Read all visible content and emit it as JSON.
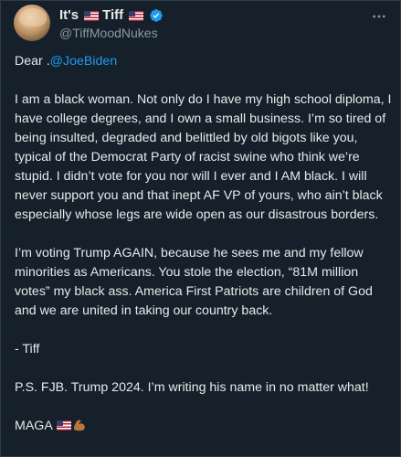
{
  "colors": {
    "background": "#15202b",
    "text": "#e7e9ea",
    "secondary_text": "#8b98a5",
    "link": "#1d9bf0",
    "verified": "#1d9bf0"
  },
  "author": {
    "display_name_prefix": "It's",
    "display_name_main": "Tiff",
    "handle": "@TiffMoodNukes",
    "flag_icon": "us-flag-icon",
    "verified_icon": "verified-badge-icon",
    "more_icon": "more-options-icon"
  },
  "tweet": {
    "greeting_prefix": "Dear .",
    "mention": "@JoeBiden",
    "paragraph_1": "I am a black woman. Not only do I have my high school diploma, I have college degrees, and I own a small business. I’m so tired of being insulted, degraded and belittled by old bigots like you, typical of the Democrat Party of racist swine who think we’re stupid. I didn’t vote for you nor will I ever and I AM black. I will never support you and that inept AF VP of yours, who ain’t black especially whose legs are wide open as our disastrous borders.",
    "paragraph_2": "I’m voting Trump AGAIN, because he sees me and my fellow minorities as Americans. You stole the election, “81M million votes” my black ass. America First Patriots are children of God and we are united in taking our country back.",
    "signoff": "- Tiff",
    "postscript": "P.S. FJB. Trump 2024. I’m writing his name in no matter what!",
    "closing": "MAGA",
    "closing_icons": [
      "us-flag-icon",
      "flexed-biceps-icon"
    ]
  }
}
